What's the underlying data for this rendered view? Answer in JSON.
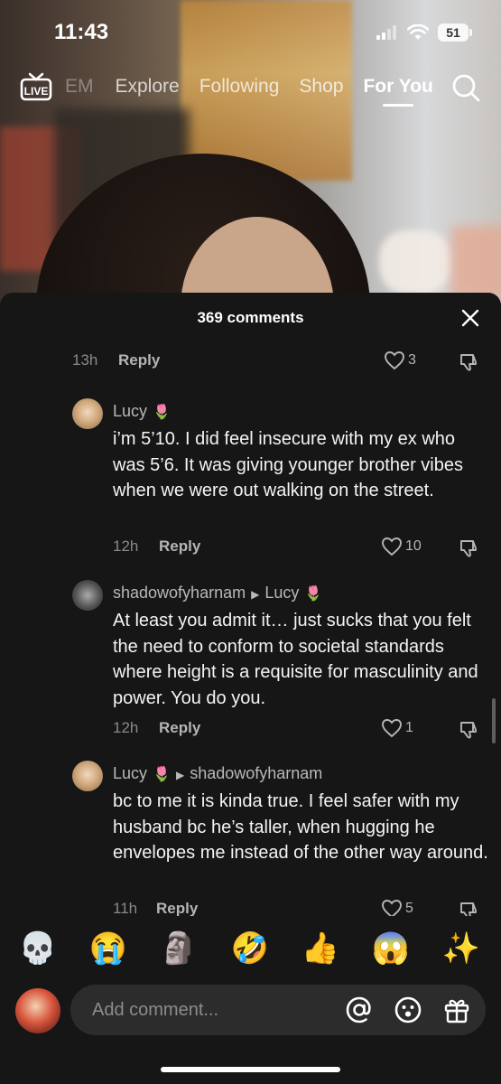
{
  "status_bar": {
    "time": "11:43",
    "battery": "51"
  },
  "top_nav": {
    "tabs": [
      {
        "label": "EM",
        "state": "faded"
      },
      {
        "label": "Explore",
        "state": "normal"
      },
      {
        "label": "Following",
        "state": "normal"
      },
      {
        "label": "Shop",
        "state": "normal"
      },
      {
        "label": "For You",
        "state": "active"
      }
    ],
    "live_icon": "live-tv-icon",
    "search_icon": "search-icon"
  },
  "comments_panel": {
    "title": "369 comments",
    "partial_top": {
      "time": "13h",
      "reply": "Reply",
      "likes": "3"
    },
    "comments": [
      {
        "author": "Lucy",
        "author_emoji": "🌷",
        "text": "i’m 5’10. I did feel insecure with my ex who was 5’6. It was giving younger brother vibes when we were out walking on the street.",
        "time": "12h",
        "reply": "Reply",
        "likes": "10"
      },
      {
        "author": "shadowofyharnam",
        "reply_to": "Lucy",
        "reply_to_emoji": "🌷",
        "text": "At least you admit it… just sucks that you felt the need to conform to societal standards where height is a requisite for masculinity and power. You do you.",
        "time": "12h",
        "reply": "Reply",
        "likes": "1"
      },
      {
        "author": "Lucy",
        "author_emoji": "🌷",
        "reply_to": "shadowofyharnam",
        "text": "bc to me it is kinda true. I feel safer with my husband bc he’s taller, when hugging he envelopes me instead of the other way around.",
        "time": "11h",
        "reply": "Reply",
        "likes": "5"
      }
    ]
  },
  "emoji_bar": [
    "💀",
    "😭",
    "🗿",
    "🤣",
    "👍",
    "😱",
    "✨"
  ],
  "input_bar": {
    "placeholder": "Add comment..."
  }
}
